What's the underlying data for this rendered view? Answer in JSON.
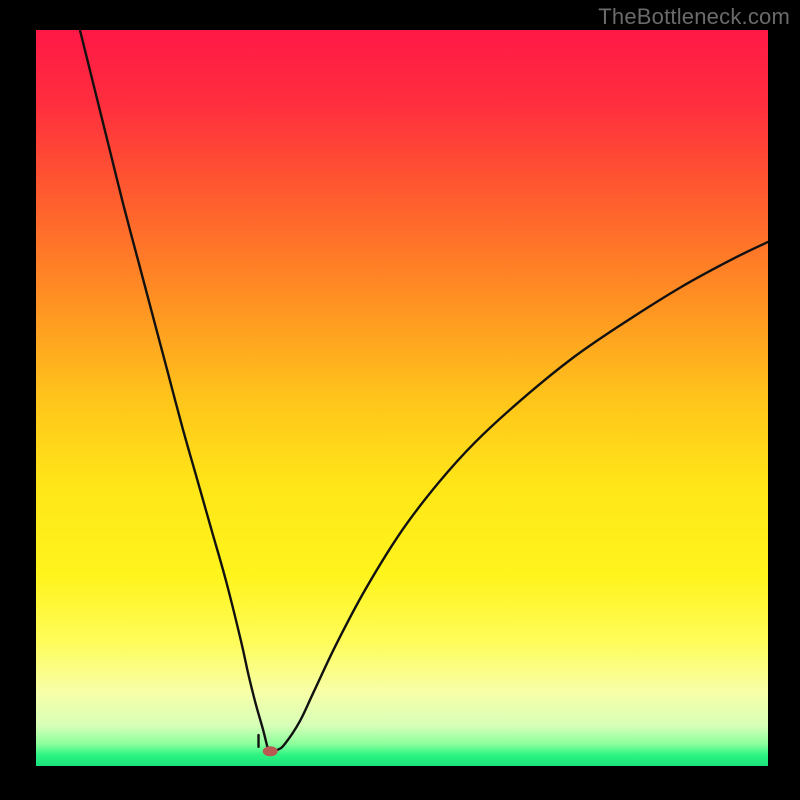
{
  "watermark": "TheBottleneck.com",
  "gradient": {
    "stops": [
      {
        "offset": 0.0,
        "color": "#ff1846"
      },
      {
        "offset": 0.1,
        "color": "#ff2e3e"
      },
      {
        "offset": 0.22,
        "color": "#ff5a2f"
      },
      {
        "offset": 0.35,
        "color": "#ff8a24"
      },
      {
        "offset": 0.5,
        "color": "#ffc41b"
      },
      {
        "offset": 0.62,
        "color": "#ffe618"
      },
      {
        "offset": 0.74,
        "color": "#fff41c"
      },
      {
        "offset": 0.83,
        "color": "#fffc59"
      },
      {
        "offset": 0.9,
        "color": "#f7ffa8"
      },
      {
        "offset": 0.945,
        "color": "#d7ffb8"
      },
      {
        "offset": 0.97,
        "color": "#8cff9c"
      },
      {
        "offset": 0.985,
        "color": "#2cf583"
      },
      {
        "offset": 1.0,
        "color": "#18e27a"
      }
    ]
  },
  "chart_data": {
    "type": "line",
    "title": "",
    "xlabel": "",
    "ylabel": "",
    "xlim": [
      0,
      100
    ],
    "ylim": [
      0,
      100
    ],
    "x": [
      6,
      8,
      10,
      12,
      14,
      16,
      18,
      20,
      22,
      24,
      26,
      28,
      29,
      30,
      31,
      31.7,
      32,
      33,
      34,
      36,
      38,
      41,
      45,
      50,
      55,
      60,
      66,
      73,
      80,
      88,
      95,
      100
    ],
    "values": [
      100,
      92,
      84,
      76,
      68.5,
      61,
      53.5,
      46,
      39,
      32,
      25,
      17,
      12.5,
      8.5,
      5,
      2.3,
      2,
      2.2,
      3,
      6,
      10.2,
      16.5,
      24,
      32,
      38.5,
      44,
      49.5,
      55.2,
      60,
      65,
      68.8,
      71.2
    ],
    "marker": {
      "x": 32,
      "y": 2
    },
    "notch": {
      "x": 30.4,
      "y_from": 2.6,
      "y_to": 4.2
    }
  }
}
